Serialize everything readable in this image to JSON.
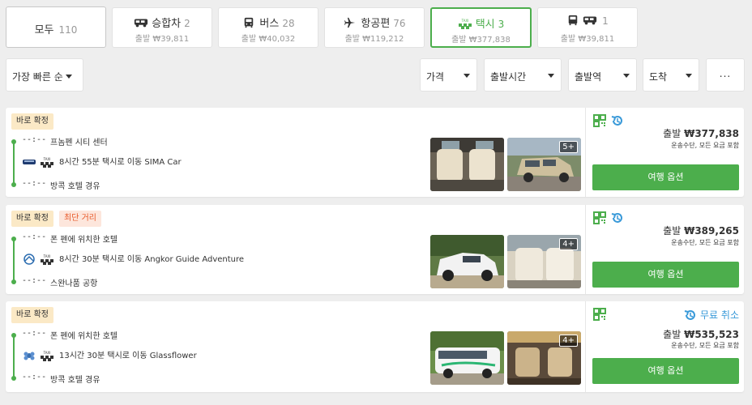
{
  "tabs": {
    "all": {
      "label": "모두",
      "count": "110"
    },
    "car": {
      "label": "승합차",
      "count": "2",
      "price": "출발 ₩39,811"
    },
    "bus": {
      "label": "버스",
      "count": "28",
      "price": "출발 ₩40,032"
    },
    "flight": {
      "label": "항공편",
      "count": "76",
      "price": "출발 ₩119,212"
    },
    "taxi": {
      "label": "택시",
      "count": "3",
      "price": "출발 ₩377,838"
    },
    "combo": {
      "label": "",
      "count": "1",
      "price": "출발 ₩39,811"
    }
  },
  "filters": {
    "sort": "가장 빠른 순",
    "price": "가격",
    "departure_time": "출발시간",
    "departure_station": "출발역",
    "arrival": "도착",
    "more": "..."
  },
  "colors": {
    "accent": "#4cae4c",
    "link": "#3a9ad9"
  },
  "results": [
    {
      "badges": [
        "바로 확정"
      ],
      "dep_time": "--:--",
      "from": "프놈펜 시티 센터",
      "duration": "8시간 55분 택시로 이동 SIMA Car",
      "arr_time": "--:--",
      "to": "방콕 호텔 경유",
      "photo_more": "5+",
      "price_prefix": "출발",
      "price": "₩377,838",
      "note": "운송수단, 모든 요금 포함",
      "button": "여행 옵션"
    },
    {
      "badges": [
        "바로 확정",
        "최단 거리"
      ],
      "dep_time": "--:--",
      "from": "폰 펜에 위치한 호텔",
      "duration": "8시간 30분 택시로 이동 Angkor Guide Adventure",
      "arr_time": "--:--",
      "to": "스완나품 공항",
      "photo_more": "4+",
      "price_prefix": "출발",
      "price": "₩389,265",
      "note": "운송수단, 모든 요금 포함",
      "button": "여행 옵션"
    },
    {
      "badges": [
        "바로 확정"
      ],
      "dep_time": "--:--",
      "from": "폰 펜에 위치한 호텔",
      "duration": "13시간 30분 택시로 이동 Glassflower",
      "arr_time": "--:--",
      "to": "방콕 호텔 경유",
      "photo_more": "4+",
      "free_cancel": "무료 취소",
      "price_prefix": "출발",
      "price": "₩535,523",
      "note": "운송수단, 모든 요금 포함",
      "button": "여행 옵션"
    }
  ]
}
